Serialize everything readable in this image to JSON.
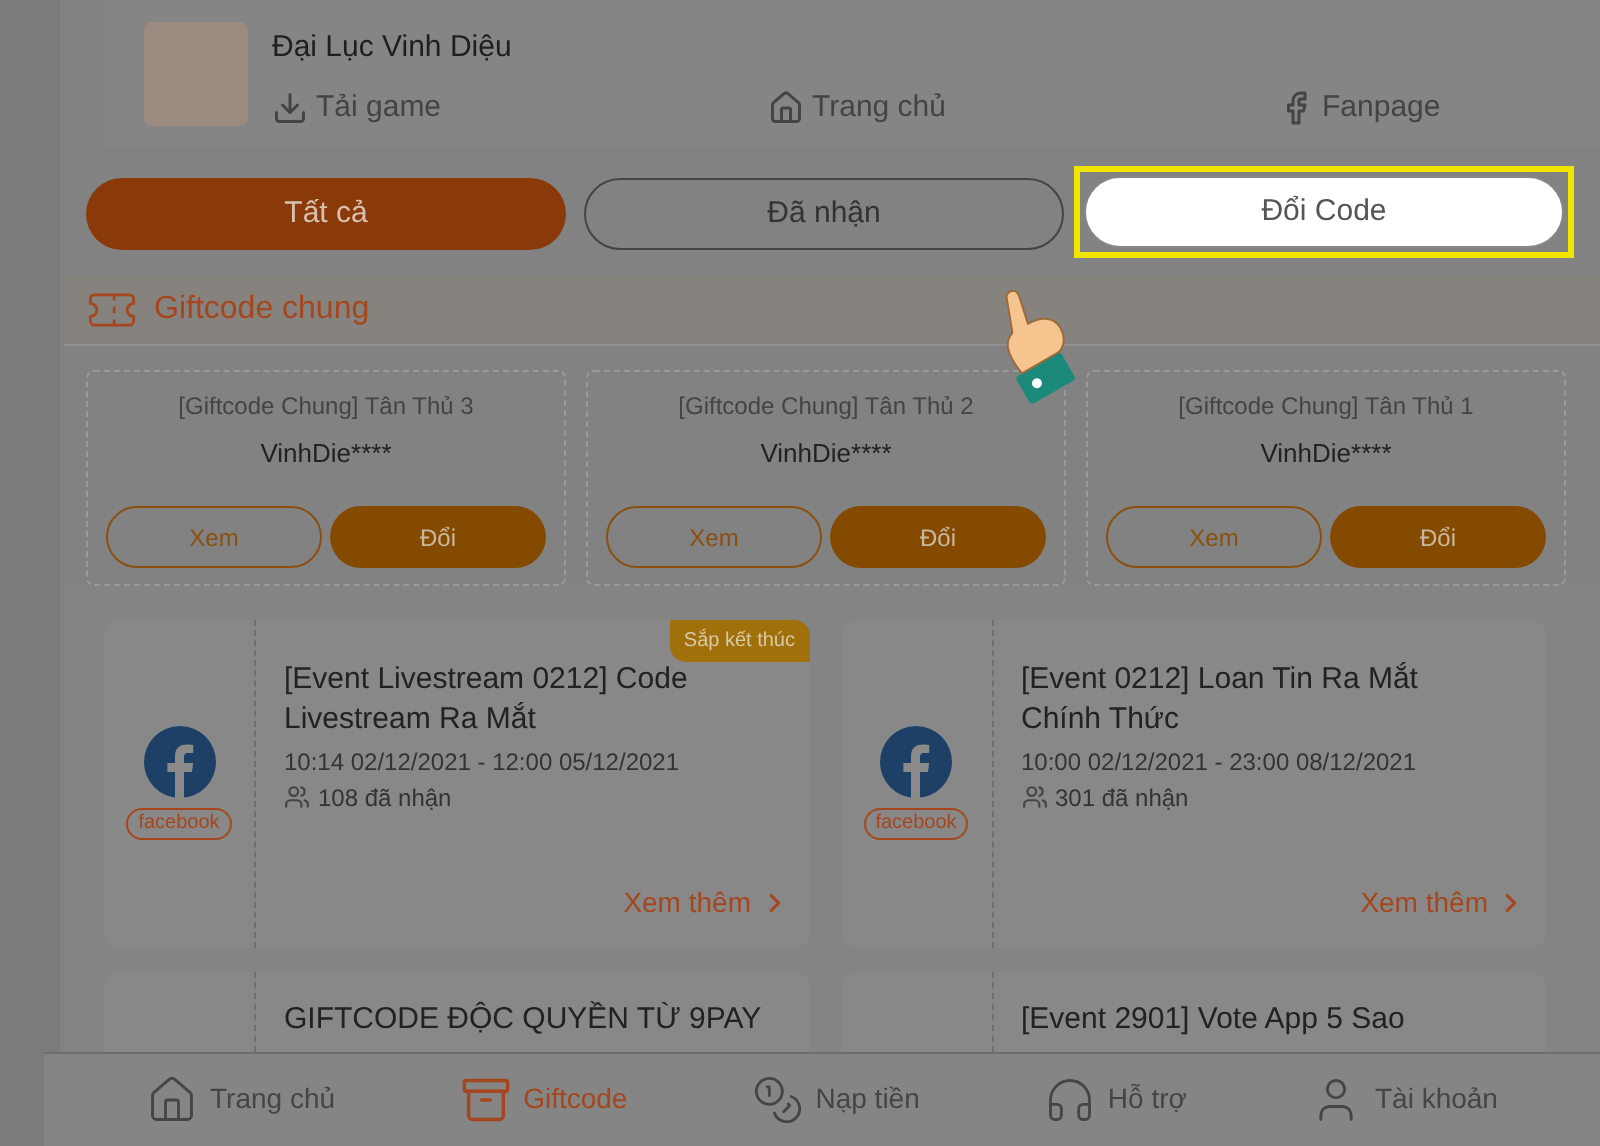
{
  "game": {
    "name": "Đại Lục Vinh Diệu"
  },
  "header_links": [
    {
      "label": "Tải game",
      "kind": "download"
    },
    {
      "label": "Trang chủ",
      "kind": "home"
    },
    {
      "label": "Fanpage",
      "kind": "facebook"
    }
  ],
  "tabs": [
    {
      "label": "Tất cả",
      "selected": true,
      "highlighted": false
    },
    {
      "label": "Đã nhận",
      "selected": false,
      "highlighted": false
    },
    {
      "label": "Đổi Code",
      "selected": false,
      "highlighted": true
    }
  ],
  "section": {
    "title": "Giftcode chung"
  },
  "giftcodes": [
    {
      "title": "[Giftcode Chung] Tân Thủ 3",
      "code": "VinhDie****",
      "view": "Xem",
      "redeem": "Đổi"
    },
    {
      "title": "[Giftcode Chung] Tân Thủ 2",
      "code": "VinhDie****",
      "view": "Xem",
      "redeem": "Đổi"
    },
    {
      "title": "[Giftcode Chung] Tân Thủ 1",
      "code": "VinhDie****",
      "view": "Xem",
      "redeem": "Đổi"
    }
  ],
  "events": [
    {
      "kind": "full",
      "source": "facebook",
      "badge": "Sắp kết thúc",
      "title": "[Event Livestream 0212] Code Livestream Ra Mắt",
      "time": "10:14 02/12/2021 - 12:00 05/12/2021",
      "claimed": "108 đã nhận",
      "more": "Xem thêm"
    },
    {
      "kind": "full",
      "source": "facebook",
      "title": "[Event 0212] Loan Tin Ra Mắt Chính Thức",
      "time": "10:00 02/12/2021 - 23:00 08/12/2021",
      "claimed": "301 đã nhận",
      "more": "Xem thêm"
    },
    {
      "kind": "partial",
      "title": "GIFTCODE ĐỘC QUYỀN TỪ 9PAY"
    },
    {
      "kind": "partial",
      "title": "[Event 2901] Vote App 5 Sao"
    }
  ],
  "bottom_nav": [
    {
      "label": "Trang chủ",
      "kind": "home",
      "selected": false
    },
    {
      "label": "Giftcode",
      "kind": "gift",
      "selected": true
    },
    {
      "label": "Nạp tiền",
      "kind": "coins",
      "selected": false
    },
    {
      "label": "Hỗ trợ",
      "kind": "headset",
      "selected": false
    },
    {
      "label": "Tài khoản",
      "kind": "user",
      "selected": false
    }
  ]
}
